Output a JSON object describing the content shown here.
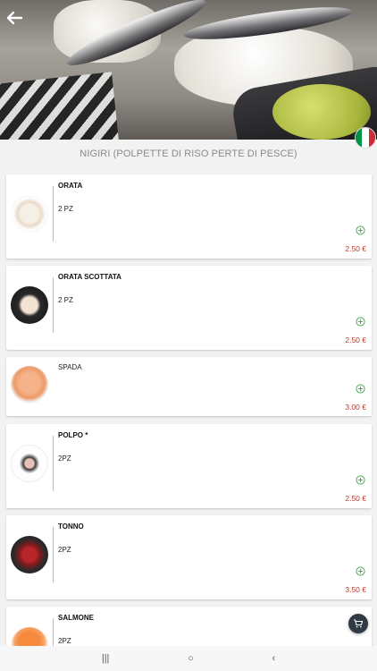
{
  "section_title": "NIGIRI (POLPETTE DI RISO PERTE DI PESCE)",
  "currency_colors": {
    "price": "#c0392b",
    "add": "#4caf50"
  },
  "flag_colors": [
    "#009246",
    "#ffffff",
    "#ce2b37"
  ],
  "icons": {
    "back": "arrow-left-icon",
    "add": "plus-circle-icon",
    "cart": "cart-icon"
  },
  "items": [
    {
      "name": "ORATA",
      "desc": "2 PZ",
      "price": "2.50 €"
    },
    {
      "name": "ORATA SCOTTATA",
      "desc": "2 PZ",
      "price": "2.50 €"
    },
    {
      "name": "",
      "desc": "SPADA",
      "price": "3.00 €"
    },
    {
      "name": "POLPO *",
      "desc": "2PZ",
      "price": "2.50 €"
    },
    {
      "name": "TONNO",
      "desc": "2PZ",
      "price": "3.50 €"
    },
    {
      "name": "SALMONE",
      "desc": "2PZ",
      "price": ""
    }
  ],
  "navbar": {
    "recents": "|||",
    "home": "○",
    "back": "‹"
  }
}
